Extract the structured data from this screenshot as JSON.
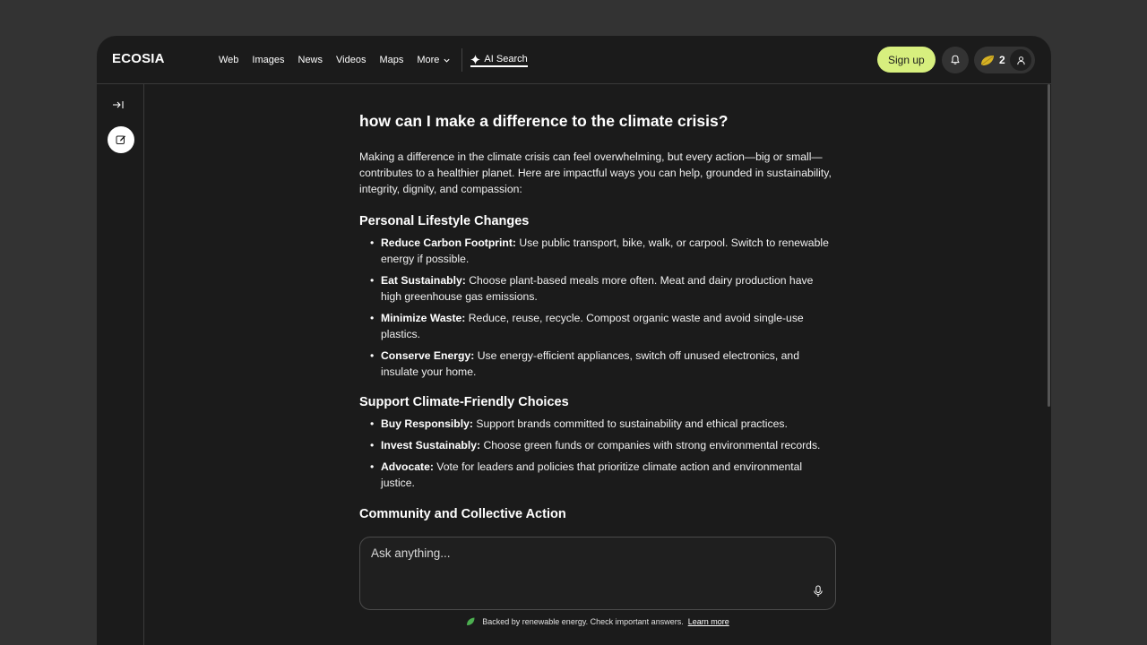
{
  "app": {
    "logo": "ECOSIA"
  },
  "nav": {
    "web": "Web",
    "images": "Images",
    "news": "News",
    "videos": "Videos",
    "maps": "Maps",
    "more": "More",
    "ai_search": "AI Search"
  },
  "header": {
    "signup": "Sign up",
    "tree_count": "2"
  },
  "main": {
    "question": "how can I make a difference to the climate crisis?",
    "intro": "Making a difference in the climate crisis can feel overwhelming, but every action—big or small—contributes to a healthier planet. Here are impactful ways you can help, grounded in sustainability, integrity, dignity, and compassion:",
    "sections": [
      {
        "heading": "Personal Lifestyle Changes",
        "items": [
          {
            "term": "Reduce Carbon Footprint:",
            "text": " Use public transport, bike, walk, or carpool. Switch to renewable energy if possible."
          },
          {
            "term": "Eat Sustainably:",
            "text": " Choose plant-based meals more often. Meat and dairy production have high greenhouse gas emissions."
          },
          {
            "term": "Minimize Waste:",
            "text": " Reduce, reuse, recycle. Compost organic waste and avoid single-use plastics."
          },
          {
            "term": "Conserve Energy:",
            "text": " Use energy-efficient appliances, switch off unused electronics, and insulate your home."
          }
        ]
      },
      {
        "heading": "Support Climate-Friendly Choices",
        "items": [
          {
            "term": "Buy Responsibly:",
            "text": " Support brands committed to sustainability and ethical practices."
          },
          {
            "term": "Invest Sustainably:",
            "text": " Choose green funds or companies with strong environmental records."
          },
          {
            "term": "Advocate:",
            "text": " Vote for leaders and policies that prioritize climate action and environmental justice."
          }
        ]
      },
      {
        "heading": "Community and Collective Action"
      }
    ]
  },
  "ask": {
    "placeholder": "Ask anything..."
  },
  "footer": {
    "note": "Backed by renewable energy. Check important answers.",
    "link": "Learn more"
  },
  "colors": {
    "accent": "#d7ef7e",
    "leaf": "#4caf50",
    "background": "#1b1b1b"
  }
}
